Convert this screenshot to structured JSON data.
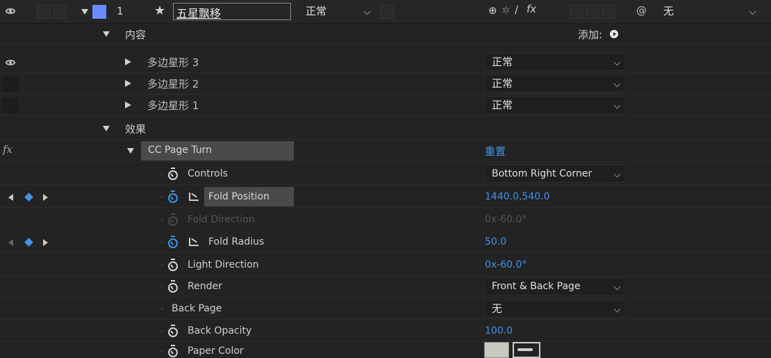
{
  "layer": {
    "number": "1",
    "name": "五星飘移",
    "mode": "正常",
    "trkmat": "无",
    "color": "#6a8cff"
  },
  "contents": {
    "label": "内容",
    "add_label": "添加:",
    "shapes": [
      {
        "name": "多边星形 3",
        "mode": "正常"
      },
      {
        "name": "多边星形 2",
        "mode": "正常"
      },
      {
        "name": "多边星形 1",
        "mode": "正常"
      }
    ]
  },
  "effects": {
    "label": "效果",
    "fx_label": "fx",
    "effect_name": "CC Page Turn",
    "reset_label": "重置"
  },
  "properties": {
    "controls": {
      "label": "Controls",
      "value": "Bottom Right Corner"
    },
    "fold_position": {
      "label": "Fold Position",
      "value": "1440.0,540.0"
    },
    "fold_direction": {
      "label": "Fold Direction",
      "value": "0x-60.0°"
    },
    "fold_radius": {
      "label": "Fold Radius",
      "value": "50.0"
    },
    "light_direction": {
      "label": "Light Direction",
      "value": "0x-60.0°"
    },
    "render": {
      "label": "Render",
      "value": "Front & Back Page"
    },
    "back_page": {
      "label": "Back Page",
      "value": "无"
    },
    "back_opacity": {
      "label": "Back Opacity",
      "value": "100.0"
    },
    "paper_color": {
      "label": "Paper Color",
      "swatch": "#c9c9bf"
    }
  },
  "colors": {
    "accent": "#3f93e6",
    "background": "#232323"
  }
}
